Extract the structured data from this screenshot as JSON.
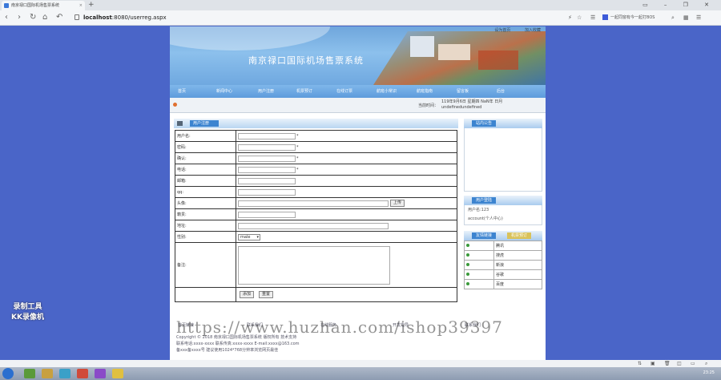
{
  "browser": {
    "tab_title": "南京禄口国际机场售票系统",
    "tab_close": "×",
    "new_tab": "+",
    "url_host": "localhost",
    "url_rest": ":8080/userreg.aspx",
    "search_placeholder": "一起同窗有今一起打BOS",
    "window_controls": "▭ – ❐ ✕"
  },
  "site": {
    "title": "南京禄口国际机场售票系统",
    "top_links": [
      "设为首页",
      "加入收藏"
    ],
    "menu": [
      "首页",
      "新闻中心",
      "用户注册",
      "机票预订",
      "在线订票",
      "航班小常识",
      "航班指南",
      "留言板",
      "后台"
    ],
    "info_label": "当前时间：",
    "info_line1": "119年9月6日 星期四 NaN年 日月",
    "info_line2": "undefinedundefined",
    "form_panel_title": "用户注册",
    "form": {
      "username": "用户名:",
      "password": "密码:",
      "confirm": "确认:",
      "phone": "电话:",
      "email": "邮箱:",
      "qq": "qq:",
      "avatar": "头像:",
      "upload": "上传",
      "age": "籍贯:",
      "address": "地址:",
      "gender": "性别:",
      "gender_value": "male",
      "remark": "备注:",
      "add_button": "添加",
      "reset_button": "重置",
      "required_mark": "*"
    },
    "side1_title": "站内公告",
    "side2_title": "用户登陆",
    "side2_line1": "用户名:123",
    "side2_line2": "account(个人中心)",
    "side3_tab1": "友情链接",
    "side3_tab2": "机票预订",
    "links": [
      "腾讯",
      "搜虎",
      "新浪",
      "谷歌",
      "百度"
    ],
    "footer_links": [
      "首页链接",
      "联系我们",
      "在线服务",
      "开发指导",
      "联系我们"
    ],
    "footer_line1": "Copyright © 2018 南京禄口国际机场售票系统 版权所有 技术支持",
    "footer_line2": "联系电话:xxxx-xxxx 联系传真:xxxx-xxxx E-mail:xxxx@163.com",
    "footer_line3": "备xxx备xxxx号  建议使用1024*768分辨率浏览网页最佳",
    "watermark": "https://www.huzhan.com/ishop39397",
    "recorder": "录制工具\nKK录像机"
  },
  "taskbar": {
    "clock": "23:25"
  }
}
